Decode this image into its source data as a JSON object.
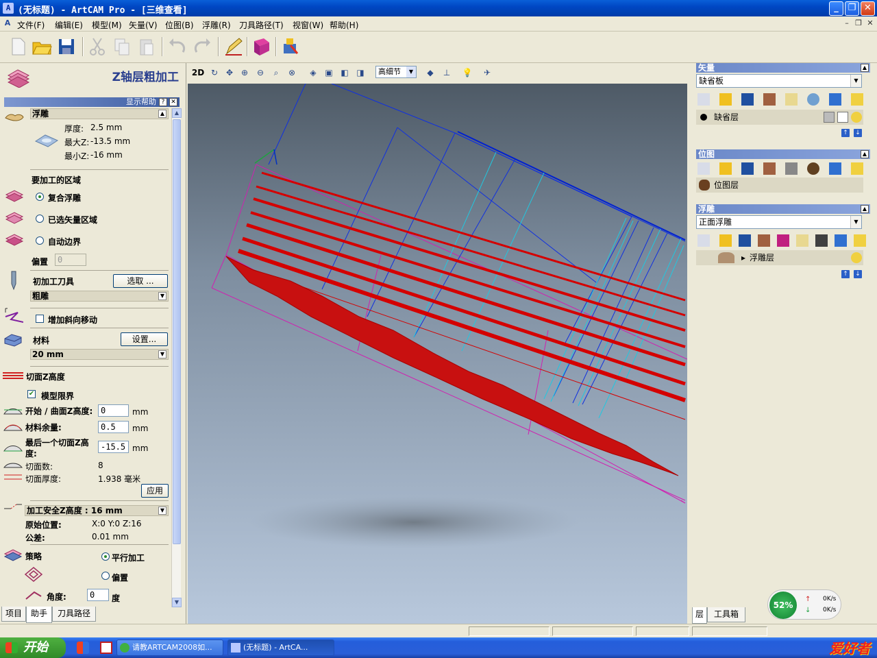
{
  "window": {
    "title": "(无标题) - ArtCAM Pro - [三维查看]",
    "app_icon": "artcam-logo-icon",
    "controls": [
      "minimize-icon",
      "maximize-icon",
      "close-icon"
    ]
  },
  "menu": {
    "items": [
      "文件(F)",
      "编辑(E)",
      "模型(M)",
      "矢量(V)",
      "位图(B)",
      "浮雕(R)",
      "刀具路径(T)",
      "视窗(W)",
      "帮助(H)"
    ]
  },
  "left_panel": {
    "title": "Z轴层粗加工",
    "help_bar": "显示帮助",
    "relief_header": "浮雕",
    "thickness_label": "厚度:",
    "thickness_value": "2.5 mm",
    "maxz_label": "最大Z:",
    "maxz_value": "-13.5 mm",
    "minz_label": "最小Z:",
    "minz_value": "-16 mm",
    "area_label": "要加工的区域",
    "area_options": [
      "复合浮雕",
      "已选矢量区域",
      "自动边界"
    ],
    "area_selected": 0,
    "offset_label": "偏置",
    "offset_value": "0",
    "rough_tool_label": "初加工刀具",
    "select_button": "选取 ...",
    "tool_name": "粗雕",
    "ramp_label": "增加斜向移动",
    "material_label": "材料",
    "material_button": "设置...",
    "material_value": "20 mm",
    "slice_z_label": "切面Z高度",
    "model_limit_label": "模型限界",
    "start_label": "开始 / 曲面Z高度:",
    "start_value": "0",
    "start_unit": "mm",
    "allowance_label": "材料余量:",
    "allowance_value": "0.5",
    "allowance_unit": "mm",
    "last_slice_label_1": "最后一个切面Z高",
    "last_slice_label_2": "度:",
    "last_slice_value": "-15.5",
    "last_slice_unit": "mm",
    "slice_count_label": "切面数:",
    "slice_count_value": "8",
    "slice_thickness_label": "切面厚度:",
    "slice_thickness_value": "1.938 毫米",
    "apply_button": "应用",
    "safe_z_header": "加工安全Z高度 : 16 mm",
    "home_label": "原始位置:",
    "home_value": "X:0 Y:0 Z:16",
    "tolerance_label": "公差:",
    "tolerance_value": "0.01 mm",
    "strategy_label": "策略",
    "strategy_options": [
      "平行加工",
      "偏置"
    ],
    "strategy_selected": 0,
    "angle_label": "角度:",
    "angle_value": "0",
    "angle_unit": "度",
    "tabs": [
      "项目",
      "助手",
      "刀具路径"
    ],
    "active_tab": 1
  },
  "view_toolbar": {
    "mode_2d": "2D",
    "detail_select": "高细节"
  },
  "right_panel": {
    "vector_header": "矢量",
    "vector_combo": "缺省板",
    "vector_layer": "缺省层",
    "bitmap_header": "位图",
    "bitmap_layer": "位图层",
    "relief_header": "浮雕",
    "relief_combo": "正面浮雕",
    "relief_layer": "浮雕层",
    "tabs": [
      "层",
      "工具箱"
    ]
  },
  "net_widget": {
    "percent": "52%",
    "up": "0K/s",
    "down": "0K/s"
  },
  "taskbar": {
    "start": "开始",
    "tasks": [
      "请教ARTCAM2008如...",
      "(无标题) - ArtCA..."
    ],
    "tray_logo": "爱好者"
  },
  "colors": {
    "toolpath_red": "#d40000",
    "material_magenta": "#d020b0",
    "vector_blue": "#1030e0",
    "vector_cyan": "#20c8e0",
    "panel_header": "#6b88c8"
  }
}
